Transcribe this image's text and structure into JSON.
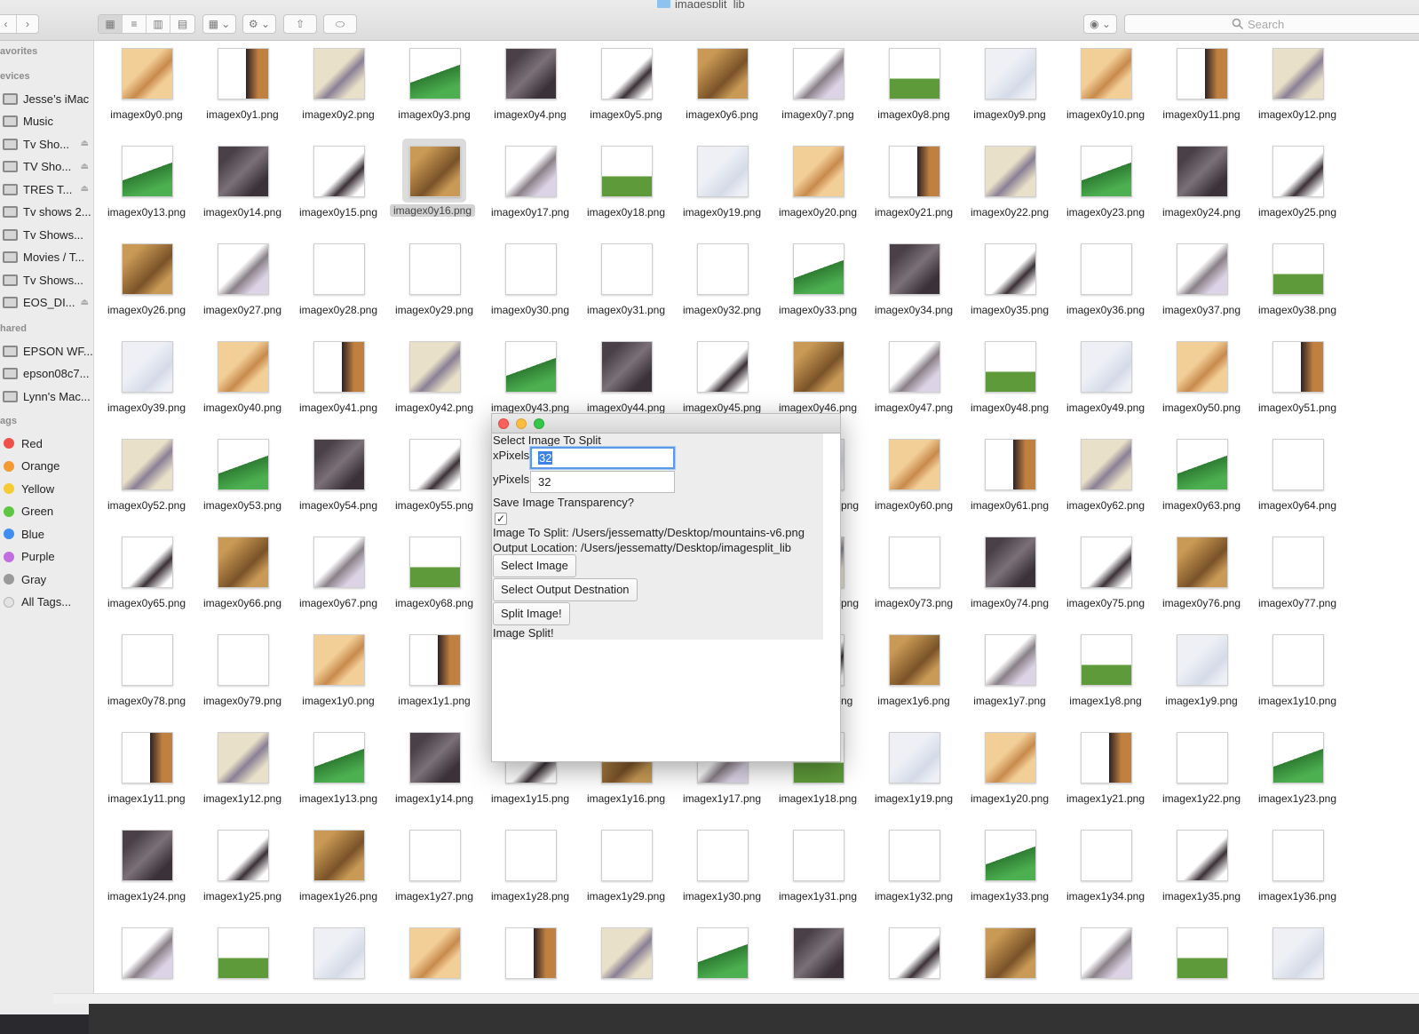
{
  "window": {
    "title": "imagesplit_lib"
  },
  "toolbar": {
    "search_placeholder": "Search",
    "back_icon": "chevron-left-icon",
    "forward_icon": "chevron-right-icon"
  },
  "sidebar": {
    "favorites_heading": "avorites",
    "devices_heading": "evices",
    "devices": [
      {
        "label": "Jesse’s iMac",
        "eject": false
      },
      {
        "label": "Music",
        "eject": false
      },
      {
        "label": "Tv  Sho...",
        "eject": true
      },
      {
        "label": "TV Sho...",
        "eject": true
      },
      {
        "label": "TRES T...",
        "eject": true
      },
      {
        "label": "Tv shows 2...",
        "eject": false
      },
      {
        "label": "Tv  Shows...",
        "eject": false
      },
      {
        "label": "Movies / T...",
        "eject": false
      },
      {
        "label": "Tv Shows...",
        "eject": false
      },
      {
        "label": "EOS_DI...",
        "eject": true
      }
    ],
    "shared_heading": "hared",
    "shared": [
      {
        "label": "EPSON WF..."
      },
      {
        "label": "epson08c7..."
      },
      {
        "label": "Lynn's Mac..."
      }
    ],
    "tags_heading": "ags",
    "tags": [
      {
        "label": "Red",
        "color": "#f0504a"
      },
      {
        "label": "Orange",
        "color": "#f39a35"
      },
      {
        "label": "Yellow",
        "color": "#f5ca33"
      },
      {
        "label": "Green",
        "color": "#5ec640"
      },
      {
        "label": "Blue",
        "color": "#3f8cf3"
      },
      {
        "label": "Purple",
        "color": "#c16fe0"
      },
      {
        "label": "Gray",
        "color": "#9a9a9a"
      },
      {
        "label": "All Tags...",
        "color": "#e3e3e3"
      }
    ]
  },
  "files": {
    "selected": "imagex0y16.png",
    "rows": [
      [
        "imagex0y0.png",
        "imagex0y1.png",
        "imagex0y2.png",
        "imagex0y3.png",
        "imagex0y4.png",
        "imagex0y5.png",
        "imagex0y6.png",
        "imagex0y7.png",
        "imagex0y8.png",
        "imagex0y9.png",
        "imagex0y10.png",
        "imagex0y11.png",
        "imagex0y12.png"
      ],
      [
        "imagex0y13.png",
        "imagex0y14.png",
        "imagex0y15.png",
        "imagex0y16.png",
        "imagex0y17.png",
        "imagex0y18.png",
        "imagex0y19.png",
        "imagex0y20.png",
        "imagex0y21.png",
        "imagex0y22.png",
        "imagex0y23.png",
        "imagex0y24.png",
        "imagex0y25.png"
      ],
      [
        "imagex0y26.png",
        "imagex0y27.png",
        "imagex0y28.png",
        "imagex0y29.png",
        "imagex0y30.png",
        "imagex0y31.png",
        "imagex0y32.png",
        "imagex0y33.png",
        "imagex0y34.png",
        "imagex0y35.png",
        "imagex0y36.png",
        "imagex0y37.png",
        "imagex0y38.png"
      ],
      [
        "imagex0y39.png",
        "imagex0y40.png",
        "imagex0y41.png",
        "imagex0y42.png",
        "imagex0y43.png",
        "imagex0y44.png",
        "imagex0y45.png",
        "imagex0y46.png",
        "imagex0y47.png",
        "imagex0y48.png",
        "imagex0y49.png",
        "imagex0y50.png",
        "imagex0y51.png"
      ],
      [
        "imagex0y52.png",
        "imagex0y53.png",
        "imagex0y54.png",
        "imagex0y55.png",
        "",
        "",
        "",
        "png",
        "imagex0y60.png",
        "imagex0y61.png",
        "imagex0y62.png",
        "imagex0y63.png",
        "imagex0y64.png"
      ],
      [
        "imagex0y65.png",
        "imagex0y66.png",
        "imagex0y67.png",
        "imagex0y68.png",
        "",
        "",
        "",
        "png",
        "imagex0y73.png",
        "imagex0y74.png",
        "imagex0y75.png",
        "imagex0y76.png",
        "imagex0y77.png"
      ],
      [
        "imagex0y78.png",
        "imagex0y79.png",
        "imagex1y0.png",
        "imagex1y1.png",
        "",
        "",
        "",
        "ng",
        "imagex1y6.png",
        "imagex1y7.png",
        "imagex1y8.png",
        "imagex1y9.png",
        "imagex1y10.png"
      ],
      [
        "imagex1y11.png",
        "imagex1y12.png",
        "imagex1y13.png",
        "imagex1y14.png",
        "imagex1y15.png",
        "imagex1y16.png",
        "imagex1y17.png",
        "imagex1y18.png",
        "imagex1y19.png",
        "imagex1y20.png",
        "imagex1y21.png",
        "imagex1y22.png",
        "imagex1y23.png"
      ],
      [
        "imagex1y24.png",
        "imagex1y25.png",
        "imagex1y26.png",
        "imagex1y27.png",
        "imagex1y28.png",
        "imagex1y29.png",
        "imagex1y30.png",
        "imagex1y31.png",
        "imagex1y32.png",
        "imagex1y33.png",
        "imagex1y34.png",
        "imagex1y35.png",
        "imagex1y36.png"
      ],
      [
        "",
        "",
        "",
        "",
        "",
        "",
        "",
        "",
        "",
        "",
        "",
        "",
        ""
      ]
    ]
  },
  "dialog": {
    "header": "Select Image To Split",
    "xpixels_label": "xPixels",
    "xpixels_value": "32",
    "ypixels_label": "yPixels",
    "ypixels_value": "32",
    "transparency_label": "Save Image Transparency?",
    "transparency_checked": "✓",
    "image_to_split": "Image To Split: /Users/jessematty/Desktop/mountains-v6.png",
    "output_location": "Output Location: /Users/jessematty/Desktop/imagesplit_lib",
    "select_image_button": "Select Image",
    "select_output_button": "Select Output Destnation",
    "split_button": "Split Image!",
    "status": "Image Split!"
  }
}
